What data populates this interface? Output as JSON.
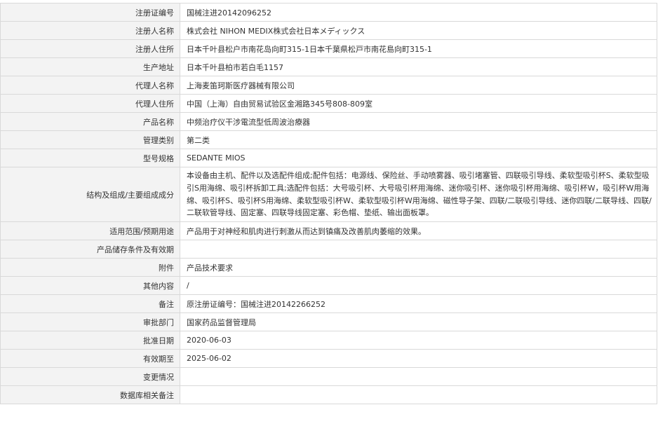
{
  "rows": [
    {
      "label": "注册证编号",
      "value": "国械注进20142096252"
    },
    {
      "label": "注册人名称",
      "value": "株式会社 NIHON MEDIX株式会社日本メディックス"
    },
    {
      "label": "注册人住所",
      "value": "日本千叶县松户市南花岛向町315-1日本千葉県松戸市南花島向町315-1"
    },
    {
      "label": "生产地址",
      "value": "日本千叶县柏市若白毛1157"
    },
    {
      "label": "代理人名称",
      "value": "上海麦笛珂斯医疗器械有限公司"
    },
    {
      "label": "代理人住所",
      "value": "中国（上海）自由贸易试验区金湘路345号808-809室"
    },
    {
      "label": "产品名称",
      "value": "中频治疗仪干涉電流型低周波治療器"
    },
    {
      "label": "管理类别",
      "value": "第二类"
    },
    {
      "label": "型号规格",
      "value": "SEDANTE MIOS"
    },
    {
      "label": "结构及组成/主要组成成分",
      "value": "本设备由主机、配件以及选配件组成;配件包括：电源线、保险丝、手动喷雾器、吸引堵塞管、四联吸引导线、柔软型吸引杯S、柔软型吸引S用海绵、吸引杯拆卸工具;选配件包括：大号吸引杯、大号吸引杯用海绵、迷你吸引杯、迷你吸引杯用海绵、吸引杯W，吸引杯W用海绵、吸引杯S、吸引杯S用海绵、柔软型吸引杯W、柔软型吸引杯W用海绵、磁性导子架、四联/二联吸引导线、迷你四联/二联导线、四联/二联软管导线、固定塞、四联导线固定塞、彩色帽、垫纸、输出面板罩。"
    },
    {
      "label": "适用范围/预期用途",
      "value": "产品用于对神经和肌肉进行刺激从而达到镇痛及改善肌肉萎缩的效果。"
    },
    {
      "label": "产品储存条件及有效期",
      "value": ""
    },
    {
      "label": "附件",
      "value": "产品技术要求"
    },
    {
      "label": "其他内容",
      "value": "/"
    },
    {
      "label": "备注",
      "value": "原注册证编号：国械注进20142266252"
    },
    {
      "label": "审批部门",
      "value": "国家药品监督管理局"
    },
    {
      "label": "批准日期",
      "value": "2020-06-03"
    },
    {
      "label": "有效期至",
      "value": "2025-06-02"
    },
    {
      "label": "变更情况",
      "value": ""
    },
    {
      "label": "数据库相关备注",
      "value": ""
    }
  ]
}
